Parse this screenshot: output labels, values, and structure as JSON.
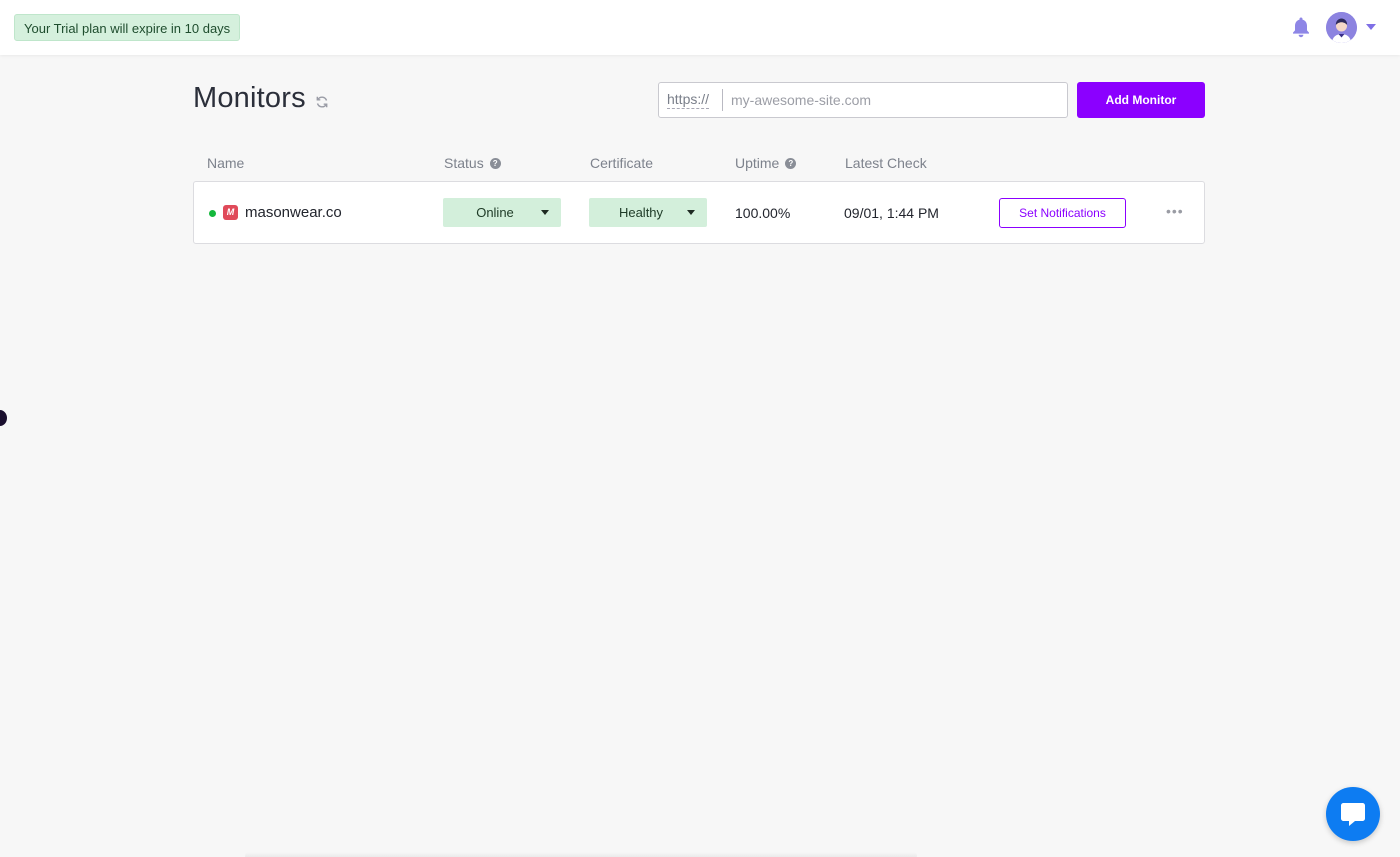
{
  "header": {
    "trial_text": "Your Trial plan will expire in 10 days",
    "bell_icon": "bell-icon",
    "avatar_icon": "user-avatar",
    "accent_color": "#7f6fe6"
  },
  "page": {
    "title": "Monitors",
    "refresh_icon": "refresh-icon"
  },
  "add_monitor": {
    "url_prefix": "https://",
    "placeholder": "my-awesome-site.com",
    "button_label": "Add Monitor",
    "button_color": "#8b00ff"
  },
  "table": {
    "columns": [
      "Name",
      "Status",
      "Certificate",
      "Uptime",
      "Latest Check"
    ],
    "rows": [
      {
        "status_dot_color": "#14b83c",
        "favicon": "M",
        "name": "masonwear.co",
        "status": "Online",
        "certificate": "Healthy",
        "uptime": "100.00%",
        "latest_check": "09/01, 1:44 PM",
        "notifications_label": "Set Notifications",
        "more_label": "•••"
      }
    ]
  },
  "chat": {
    "icon": "chat-bubble-icon",
    "color": "#0d7cf2"
  }
}
